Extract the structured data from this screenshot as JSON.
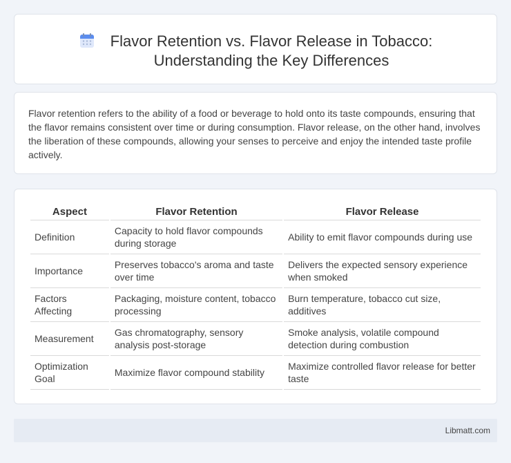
{
  "header": {
    "icon": "calendar-icon",
    "title_line1": "Flavor Retention vs. Flavor Release in Tobacco:",
    "title_line2": "Understanding the Key Differences"
  },
  "intro": {
    "text": "Flavor retention refers to the ability of a food or beverage to hold onto its taste compounds, ensuring that the flavor remains consistent over time or during consumption. Flavor release, on the other hand, involves the liberation of these compounds, allowing your senses to perceive and enjoy the intended taste profile actively."
  },
  "table": {
    "headers": [
      "Aspect",
      "Flavor Retention",
      "Flavor Release"
    ],
    "rows": [
      [
        "Definition",
        "Capacity to hold flavor compounds during storage",
        "Ability to emit flavor compounds during use"
      ],
      [
        "Importance",
        "Preserves tobacco's aroma and taste over time",
        "Delivers the expected sensory experience when smoked"
      ],
      [
        "Factors Affecting",
        "Packaging, moisture content, tobacco processing",
        "Burn temperature, tobacco cut size, additives"
      ],
      [
        "Measurement",
        "Gas chromatography, sensory analysis post-storage",
        "Smoke analysis, volatile compound detection during combustion"
      ],
      [
        "Optimization Goal",
        "Maximize flavor compound stability",
        "Maximize controlled flavor release for better taste"
      ]
    ]
  },
  "footer": {
    "brand": "Libmatt.com"
  },
  "colors": {
    "background": "#f1f4f9",
    "card": "#ffffff",
    "footer": "#e6ebf3",
    "icon_blue": "#5b8def"
  }
}
